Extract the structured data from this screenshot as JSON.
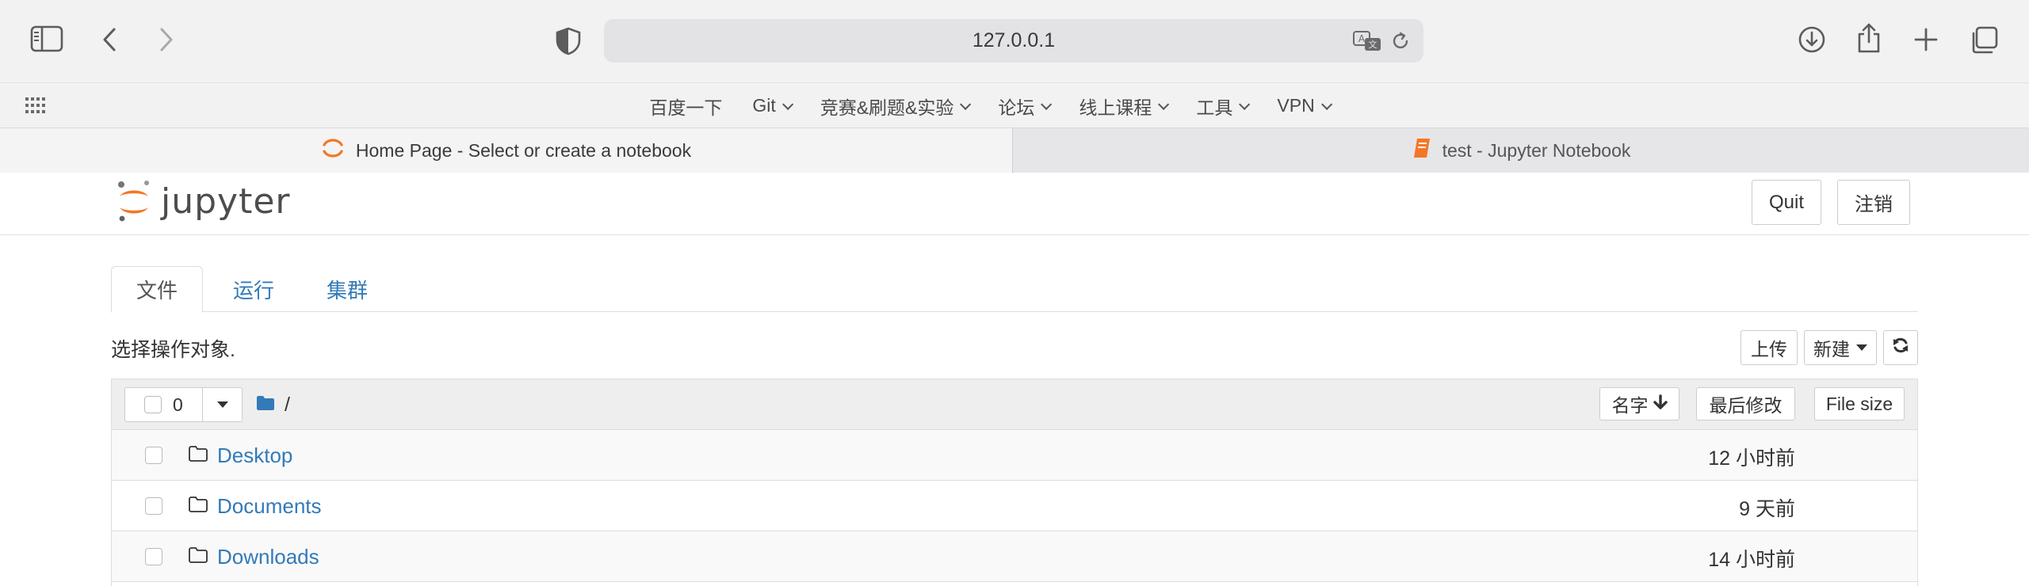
{
  "browser": {
    "url": "127.0.0.1",
    "favorites": [
      {
        "label": "百度一下",
        "dropdown": false
      },
      {
        "label": "Git",
        "dropdown": true
      },
      {
        "label": "竞赛&刷题&实验",
        "dropdown": true
      },
      {
        "label": "论坛",
        "dropdown": true
      },
      {
        "label": "线上课程",
        "dropdown": true
      },
      {
        "label": "工具",
        "dropdown": true
      },
      {
        "label": "VPN",
        "dropdown": true
      }
    ],
    "tabs": [
      {
        "title": "Home Page - Select or create a notebook",
        "active": true
      },
      {
        "title": "test - Jupyter Notebook",
        "active": false
      }
    ]
  },
  "jupyter": {
    "logo_text": "jupyter",
    "quit_label": "Quit",
    "logout_label": "注销",
    "tabs": [
      "文件",
      "运行",
      "集群"
    ],
    "select_prompt": "选择操作对象.",
    "upload_label": "上传",
    "new_label": "新建",
    "selected_count": "0",
    "breadcrumb": "/",
    "sort_name_label": "名字",
    "sort_modified_label": "最后修改",
    "sort_size_label": "File size",
    "files": [
      {
        "name": "Desktop",
        "modified": "12 小时前"
      },
      {
        "name": "Documents",
        "modified": "9 天前"
      },
      {
        "name": "Downloads",
        "modified": "14 小时前"
      }
    ]
  },
  "colors": {
    "link": "#337ab7",
    "jupyter_orange": "#f37726",
    "chrome_bg": "#f2f2f3"
  }
}
